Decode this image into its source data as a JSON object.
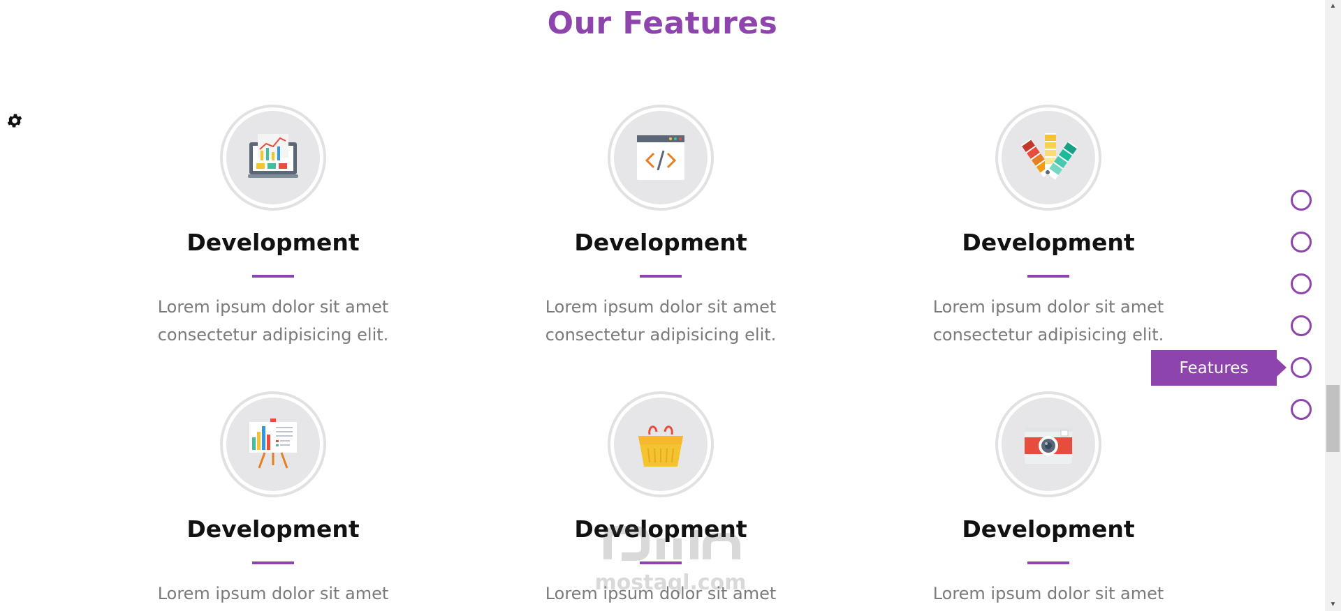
{
  "section": {
    "title": "Our Features"
  },
  "features": [
    {
      "title": "Development",
      "text": "Lorem ipsum dolor sit amet consectetur adipisicing elit.",
      "icon": "dashboard-chart-icon"
    },
    {
      "title": "Development",
      "text": "Lorem ipsum dolor sit amet consectetur adipisicing elit.",
      "icon": "code-window-icon"
    },
    {
      "title": "Development",
      "text": "Lorem ipsum dolor sit amet consectetur adipisicing elit.",
      "icon": "color-swatches-icon"
    },
    {
      "title": "Development",
      "text": "Lorem ipsum dolor sit amet",
      "icon": "presentation-board-icon"
    },
    {
      "title": "Development",
      "text": "Lorem ipsum dolor sit amet",
      "icon": "shopping-basket-icon"
    },
    {
      "title": "Development",
      "text": "Lorem ipsum dolor sit amet",
      "icon": "camera-icon"
    }
  ],
  "nav_dots": {
    "count": 6,
    "active_tooltip": "Features"
  },
  "watermark": {
    "text": "mostaql.com"
  },
  "colors": {
    "accent": "#8e44ad",
    "heading": "#111111",
    "body_text": "#7a7a7a",
    "icon_bg": "#e6e6e8"
  }
}
